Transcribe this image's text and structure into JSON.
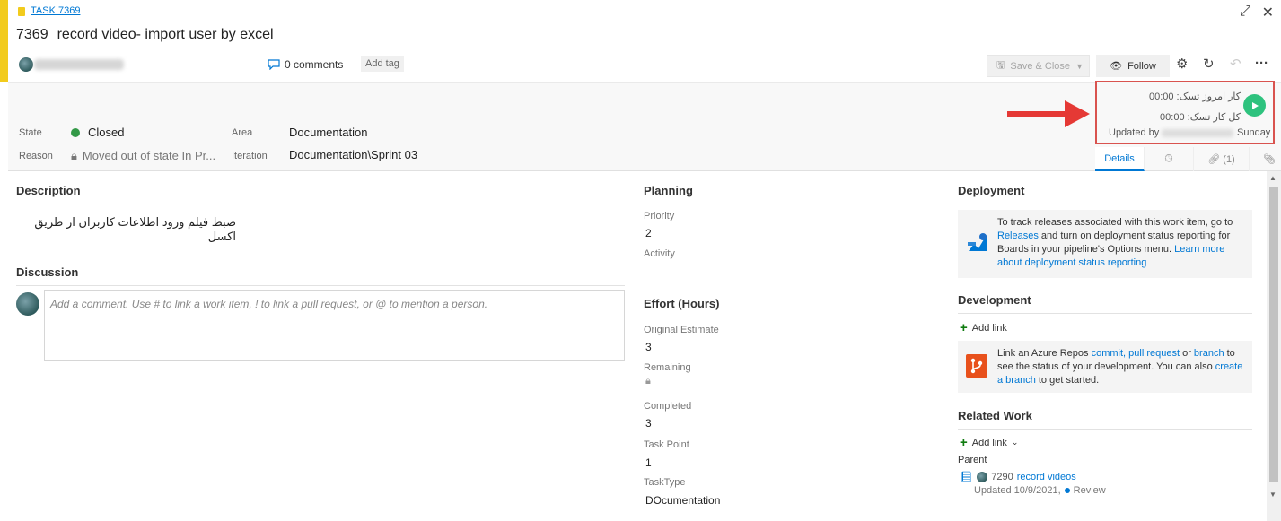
{
  "header": {
    "task_link": "TASK 7369",
    "task_number": "7369",
    "title": "record video- import user by excel",
    "comments_label": "0 comments",
    "add_tag": "Add tag",
    "save_close": "Save & Close",
    "follow": "Follow"
  },
  "fields": {
    "state_label": "State",
    "state_value": "Closed",
    "reason_label": "Reason",
    "reason_value": "Moved out of state In Pr...",
    "area_label": "Area",
    "area_value": "Documentation",
    "iteration_label": "Iteration",
    "iteration_value": "Documentation\\Sprint 03"
  },
  "timer": {
    "today": "کار امروز تسک: 00:00",
    "total": "کل کار تسک: 00:00",
    "updated_by": "Updated by",
    "day": "Sunday"
  },
  "tabs": {
    "details": "Details",
    "links_count": "(1)"
  },
  "description": {
    "heading": "Description",
    "text": "ضبط فیلم ورود اطلاعات کاربران از طریق اکسل"
  },
  "discussion": {
    "heading": "Discussion",
    "placeholder": "Add a comment. Use # to link a work item, ! to link a pull request, or @ to mention a person."
  },
  "planning": {
    "heading": "Planning",
    "priority_label": "Priority",
    "priority_value": "2",
    "activity_label": "Activity"
  },
  "effort": {
    "heading": "Effort (Hours)",
    "original_label": "Original Estimate",
    "original_value": "3",
    "remaining_label": "Remaining",
    "completed_label": "Completed",
    "completed_value": "3",
    "taskpoint_label": "Task Point",
    "taskpoint_value": "1",
    "tasktype_label": "TaskType",
    "tasktype_value": "DOcumentation"
  },
  "deployment": {
    "heading": "Deployment",
    "text1": "To track releases associated with this work item, go to",
    "releases_link": "Releases",
    "text2": "and turn on deployment status reporting for Boards in your pipeline's Options menu.",
    "learn_more": "Learn more about deployment status reporting"
  },
  "development": {
    "heading": "Development",
    "add_link": "Add link",
    "text1": "Link an Azure Repos",
    "commit_link": "commit,",
    "pr_link": "pull request",
    "text2": "or",
    "branch_link": "branch",
    "text3": "to see the status of your development. You can also",
    "create_branch_link": "create a branch",
    "text4": "to get started."
  },
  "related": {
    "heading": "Related Work",
    "add_link": "Add link",
    "parent_label": "Parent",
    "item_id": "7290",
    "item_title": "record videos",
    "item_updated": "Updated 10/9/2021,",
    "item_state": "Review"
  }
}
